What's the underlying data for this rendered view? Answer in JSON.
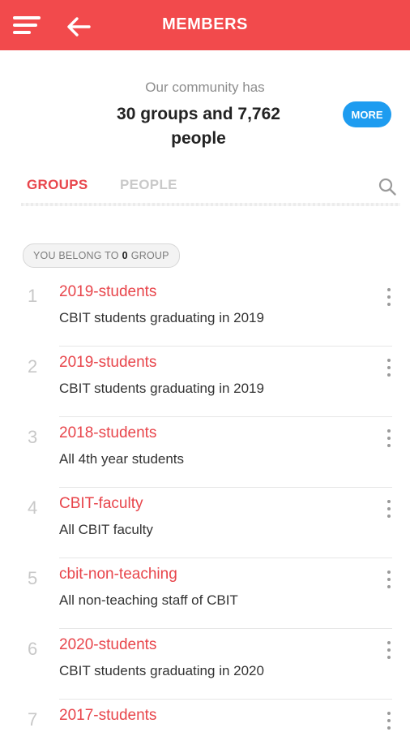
{
  "appbar": {
    "title": "MEMBERS"
  },
  "summary": {
    "subtitle": "Our community has",
    "headline": "30 groups and 7,762 people",
    "more_label": "MORE"
  },
  "tabs": [
    {
      "label": "GROUPS",
      "active": true
    },
    {
      "label": "PEOPLE",
      "active": false
    }
  ],
  "membership": {
    "prefix": "YOU BELONG TO",
    "count": "0",
    "suffix": "GROUP"
  },
  "groups": [
    {
      "num": "1",
      "name": "2019-students",
      "desc": "CBIT students graduating in 2019"
    },
    {
      "num": "2",
      "name": "2019-students",
      "desc": "CBIT students graduating in 2019"
    },
    {
      "num": "3",
      "name": "2018-students",
      "desc": "All 4th year students"
    },
    {
      "num": "4",
      "name": "CBIT-faculty",
      "desc": "All CBIT faculty"
    },
    {
      "num": "5",
      "name": "cbit-non-teaching",
      "desc": "All non-teaching staff of CBIT"
    },
    {
      "num": "6",
      "name": "2020-students",
      "desc": "CBIT students graduating in 2020"
    },
    {
      "num": "7",
      "name": "2017-students",
      "desc": ""
    }
  ],
  "colors": {
    "accent": "#F24A4C",
    "link": "#E8454B",
    "more_button": "#1E9CF0"
  },
  "icons": {
    "menu": "menu-icon",
    "back": "back-arrow-icon",
    "search": "search-icon",
    "overflow": "more-vert-icon"
  }
}
